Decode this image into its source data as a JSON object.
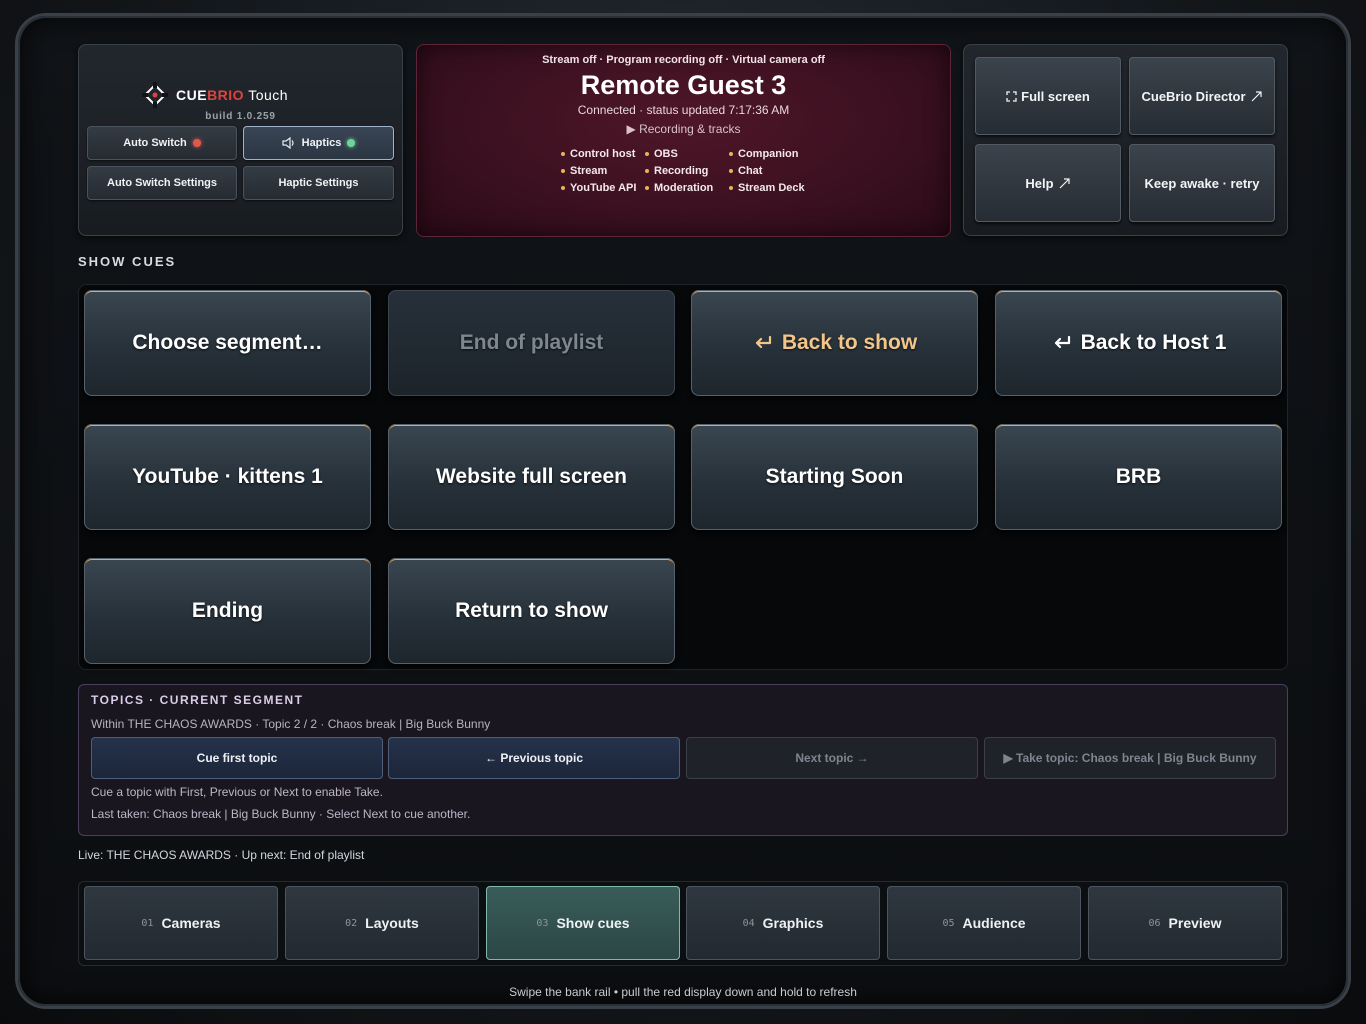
{
  "brand": {
    "name_part1": "CUE",
    "name_part2": "BRIO",
    "name_part3": "Touch",
    "build": "build 1.0.259",
    "auto_switch_label": "Auto Switch",
    "haptics_label": "Haptics",
    "auto_switch_settings_label": "Auto Switch Settings",
    "haptic_settings_label": "Haptic Settings"
  },
  "status": {
    "top_line": "Stream off · Program recording off · Virtual camera off",
    "guest_name": "Remote Guest 3",
    "connection": "Connected · status updated 7:17:36 AM",
    "recording_toggle": "▶ Recording & tracks",
    "indicators": [
      "Control host",
      "OBS",
      "Companion",
      "Stream",
      "Recording",
      "Chat",
      "YouTube API",
      "Moderation",
      "Stream Deck"
    ]
  },
  "links": {
    "full_screen": "Full screen",
    "director": "CueBrio Director",
    "help": "Help",
    "keep_awake": "Keep awake · retry"
  },
  "show_cues": {
    "title": "SHOW CUES",
    "cues": [
      {
        "label": "Choose segment…"
      },
      {
        "label": "End of playlist"
      },
      {
        "label": "Back to show"
      },
      {
        "label": "Back to Host 1"
      },
      {
        "label": "YouTube · kittens 1"
      },
      {
        "label": "Website full screen"
      },
      {
        "label": "Starting Soon"
      },
      {
        "label": "BRB"
      },
      {
        "label": "Ending"
      },
      {
        "label": "Return to show"
      }
    ]
  },
  "topics": {
    "title": "TOPICS · CURRENT SEGMENT",
    "subtitle": "Within THE CHAOS AWARDS · Topic 2 / 2 · Chaos break | Big Buck Bunny",
    "cue_first": "Cue first topic",
    "previous": "← Previous topic",
    "next": "Next topic →",
    "take": "▶ Take topic: Chaos break | Big Buck Bunny",
    "hint": "Cue a topic with First, Previous or Next to enable Take.",
    "last_taken": "Last taken: Chaos break | Big Buck Bunny · Select Next to cue another."
  },
  "live_line": "Live: THE CHAOS AWARDS · Up next: End of playlist",
  "tabs": [
    {
      "num": "01",
      "label": "Cameras"
    },
    {
      "num": "02",
      "label": "Layouts"
    },
    {
      "num": "03",
      "label": "Show cues"
    },
    {
      "num": "04",
      "label": "Graphics"
    },
    {
      "num": "05",
      "label": "Audience"
    },
    {
      "num": "06",
      "label": "Preview"
    }
  ],
  "footer_hint": "Swipe the bank rail • pull the red display down and hold to refresh",
  "colors": {
    "accent_red": "#e0433c",
    "cue_gold": "#d9a963",
    "active_tab": "#3a5d5a",
    "status_bg": "#4e1628"
  }
}
